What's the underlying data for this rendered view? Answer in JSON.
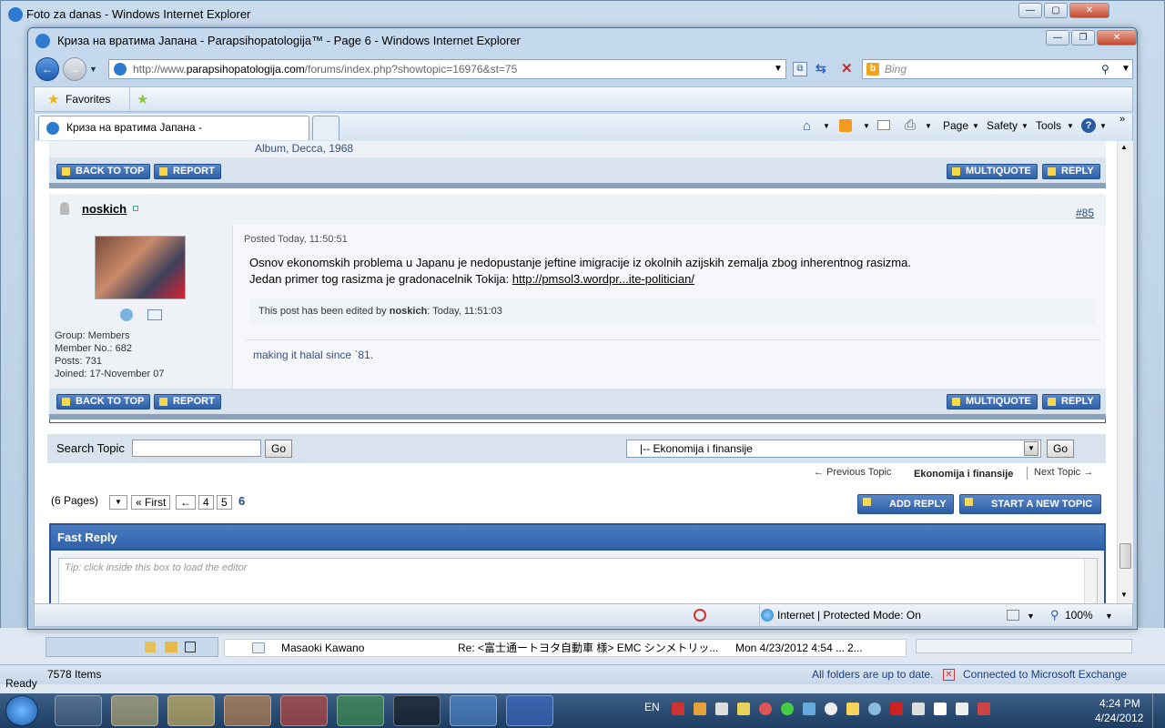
{
  "bg_window": {
    "title": "Foto za danas - Windows Internet Explorer"
  },
  "outlook": {
    "row_sender": "Masaoki Kawano",
    "row_subject": "Re: <富士通ートヨタ自動車 様> EMC シンメトリッ...",
    "row_date": "Mon 4/23/2012 4:54 ...",
    "row_size": "2...",
    "items": "7578 Items",
    "folders_status": "All folders are up to date.",
    "exchange_status": "Connected to Microsoft Exchange",
    "ready": "Ready"
  },
  "window": {
    "title": "Криза на вратима Јапана - Parapsihopatologija™ - Page 6 - Windows Internet Explorer",
    "address_prefix": "http://www.",
    "address_domain": "parapsihopatologija.com",
    "address_rest": "/forums/index.php?showtopic=16976&st=75",
    "search_placeholder": "Bing",
    "favorites_label": "Favorites",
    "tab_title": "Криза на вратима Јапана - Parapsihopatologija...",
    "cmd_page": "Page",
    "cmd_safety": "Safety",
    "cmd_tools": "Tools",
    "status_zone": "Internet | Protected Mode: On",
    "zoom": "100%"
  },
  "forum": {
    "prev_post_tail": "Album, Decca, 1968",
    "back_to_top": "BACK TO TOP",
    "report": "REPORT",
    "multiquote": "MULTIQUOTE",
    "reply": "REPLY",
    "post": {
      "author": "noskich",
      "number": "#85",
      "posted": "Posted Today, 11:50:51",
      "line1": "Osnov ekonomskih problema u Japanu je nedopustanje jeftine imigracije iz okolnih azijskih zemalja zbog inherentnog rasizma.",
      "line2": "Jedan primer tog rasizma je gradonacelnik Tokija: ",
      "link": "http://pmsol3.wordpr...ite-politician/",
      "edited_prefix": "This post has been edited by ",
      "edited_by": "noskich",
      "edited_suffix": ": Today, 11:51:03",
      "signature": "making it halal since `81.",
      "group": "Group:  Members",
      "member_no": "Member No.:  682",
      "posts": "Posts:  731",
      "joined": "Joined:  17-November 07"
    },
    "search_topic_label": "Search Topic",
    "go": "Go",
    "jump_value": "|-- Ekonomija i finansije",
    "prev_topic": "← Previous Topic",
    "forum_name": "Ekonomija i finansije",
    "next_topic": "Next Topic →",
    "pages": "(6 Pages)",
    "first": "« First",
    "back_arrow": "←",
    "page4": "4",
    "page5": "5",
    "page6": "6",
    "add_reply": "ADD REPLY",
    "start_topic": "START A NEW TOPIC",
    "fast_reply": "Fast Reply",
    "editor_tip": "Tip: click inside this box to load the editor"
  },
  "taskbar": {
    "lang": "EN",
    "time": "4:24 PM",
    "date": "4/24/2012"
  },
  "colors": {
    "accent": "#2d5ea6",
    "panel": "#d9e3ee",
    "link": "#3a4f85"
  }
}
